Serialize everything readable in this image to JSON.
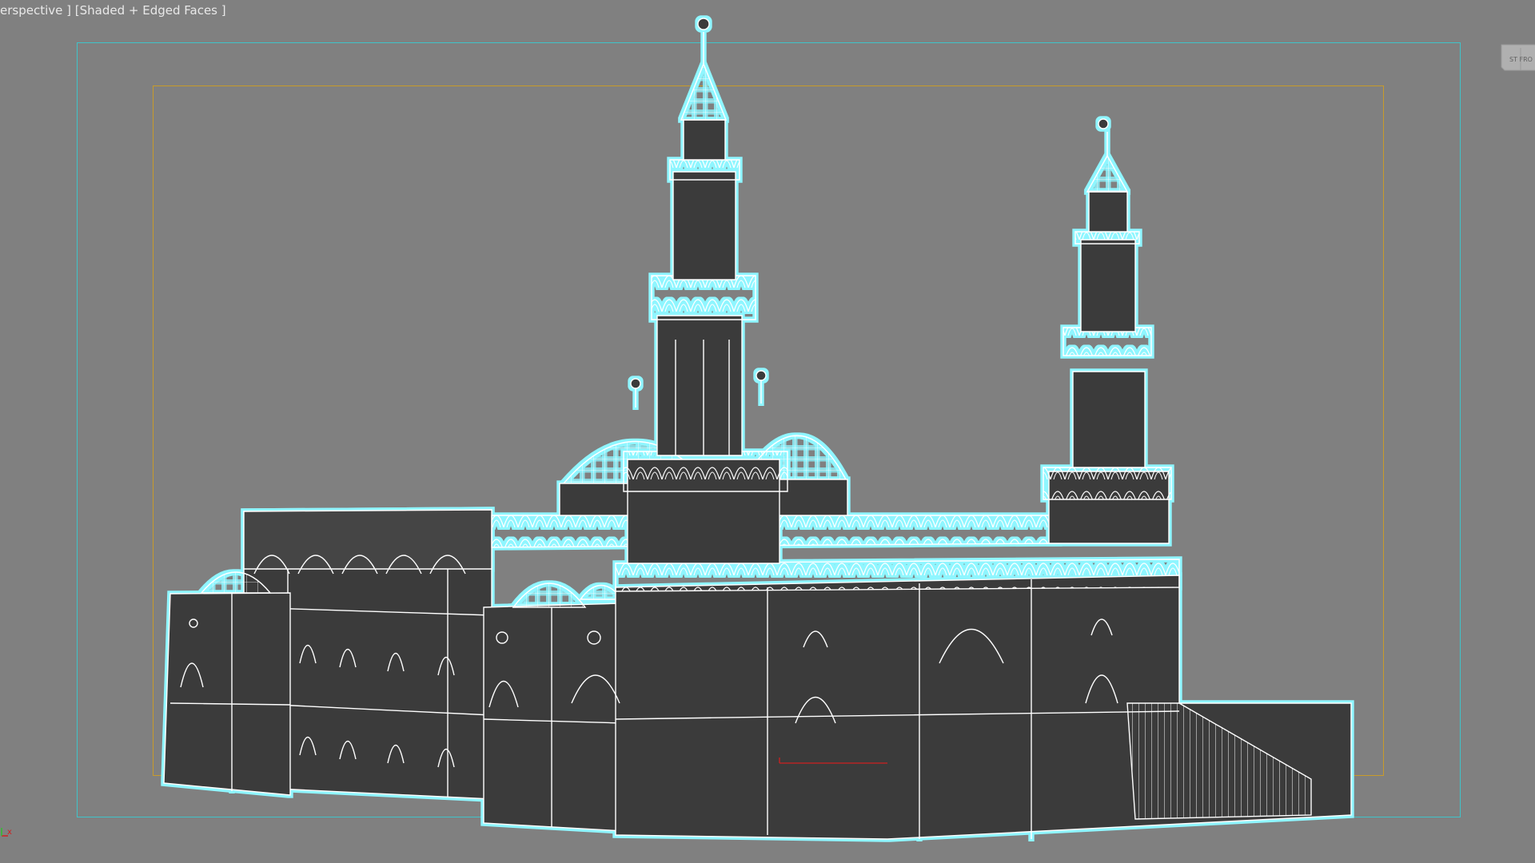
{
  "viewport": {
    "label_view": "erspective ]",
    "label_mode": "[Shaded + Edged Faces ]"
  },
  "gizmo": {
    "x_label": "x",
    "viewcube_text": "ST FRO"
  },
  "colors": {
    "background": "#808080",
    "safe_frame_outer": "#3fc3c9",
    "safe_frame_inner": "#c89b2a",
    "selection_glow": "#8ff6ff",
    "model_fill": "#3a3a3a",
    "wire": "#ffffff"
  }
}
